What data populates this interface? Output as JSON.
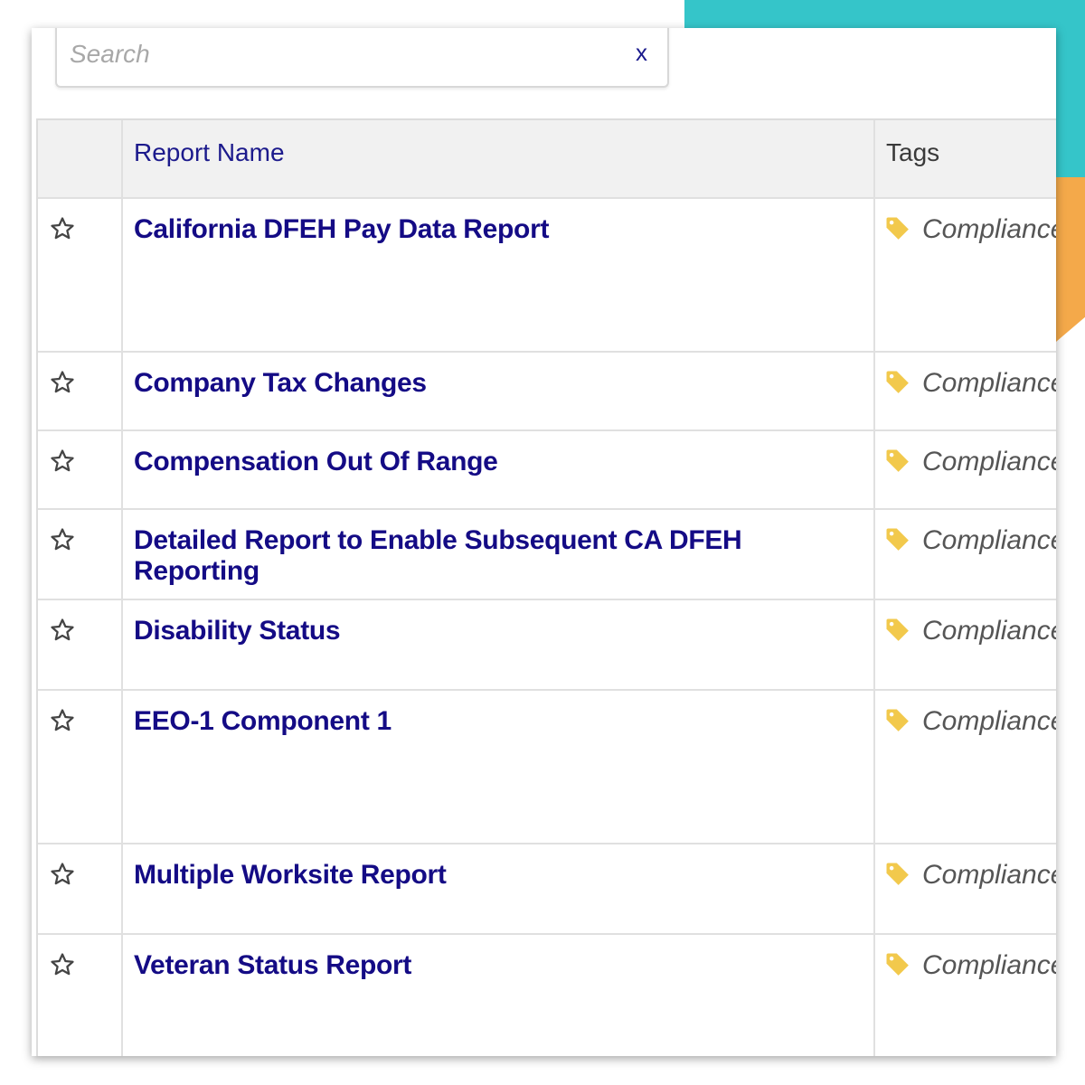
{
  "search": {
    "placeholder": "Search",
    "value": "",
    "clear_label": "x"
  },
  "table": {
    "headers": {
      "report_name": "Report Name",
      "tags": "Tags"
    },
    "rows": [
      {
        "name": "California DFEH Pay Data Report",
        "tag": "Compliance"
      },
      {
        "name": "Company Tax Changes",
        "tag": "Compliance"
      },
      {
        "name": "Compensation Out Of Range",
        "tag": "Compliance"
      },
      {
        "name": "Detailed Report to Enable Subsequent CA DFEH Reporting",
        "tag": "Compliance"
      },
      {
        "name": "Disability Status",
        "tag": "Compliance"
      },
      {
        "name": "EEO-1 Component 1",
        "tag": "Compliance"
      },
      {
        "name": "Multiple Worksite Report",
        "tag": "Compliance"
      },
      {
        "name": "Veteran Status Report",
        "tag": "Compliance"
      }
    ]
  },
  "colors": {
    "accent_teal": "#35c5c9",
    "accent_orange": "#f4a94a",
    "link": "#140b85",
    "tag_icon": "#f2c94c"
  },
  "icons": {
    "favorite": "star-outline-icon",
    "tag": "tag-icon",
    "clear": "close-icon"
  }
}
